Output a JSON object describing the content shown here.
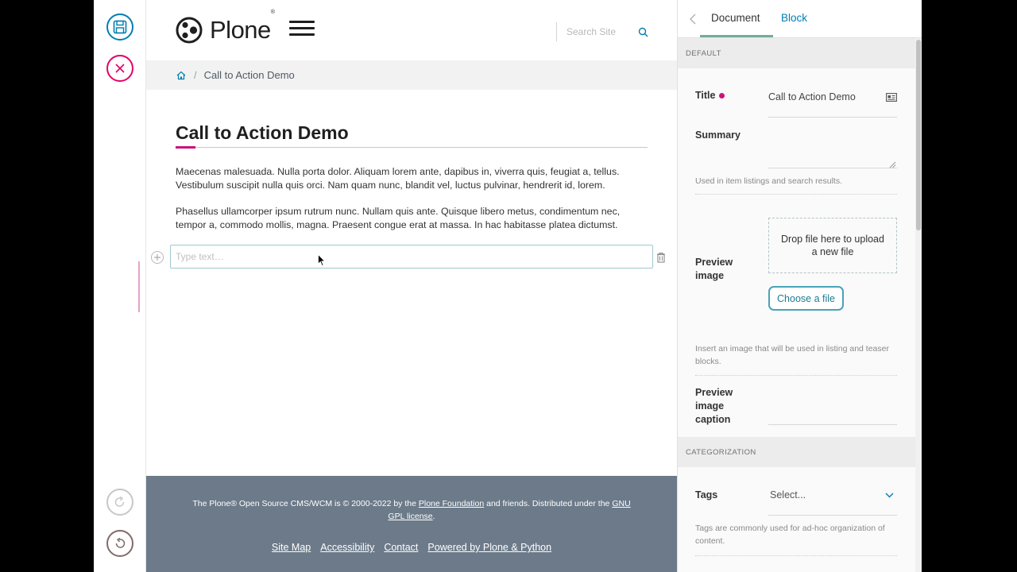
{
  "header": {
    "logo_text": "Plone",
    "logo_sup": "®",
    "search_placeholder": "Search Site"
  },
  "breadcrumb": {
    "items": [
      "Call to Action Demo"
    ]
  },
  "content": {
    "title": "Call to Action Demo",
    "paragraphs": [
      "Maecenas malesuada. Nulla porta dolor. Aliquam lorem ante, dapibus in, viverra quis, feugiat a, tellus. Vestibulum suscipit nulla quis orci. Nam quam nunc, blandit vel, luctus pulvinar, hendrerit id, lorem.",
      "Phasellus ullamcorper ipsum rutrum nunc. Nullam quis ante. Quisque libero metus, condimentum nec, tempor a, commodo mollis, magna. Praesent congue erat at massa. In hac habitasse platea dictumst."
    ],
    "text_block_placeholder": "Type text…"
  },
  "footer": {
    "text_1": "The Plone® Open Source CMS/WCM is © 2000-2022 by the ",
    "link_foundation": "Plone Foundation",
    "text_2": " and friends. Distributed under the ",
    "link_license": "GNU GPL license",
    "text_3": ".",
    "links": [
      "Site Map",
      "Accessibility",
      "Contact",
      "Powered by Plone & Python"
    ]
  },
  "sidebar": {
    "tabs": {
      "document": "Document",
      "block": "Block"
    },
    "sections": {
      "default": "DEFAULT",
      "categorization": "CATEGORIZATION"
    },
    "fields": {
      "title_label": "Title",
      "title_value": "Call to Action Demo",
      "summary_label": "Summary",
      "summary_help": "Used in item listings and search results.",
      "preview_image_label": "Preview image",
      "dropzone_text": "Drop file here to upload a new file",
      "choose_file": "Choose a file",
      "preview_image_help": "Insert an image that will be used in listing and teaser blocks.",
      "preview_caption_label": "Preview image caption",
      "tags_label": "Tags",
      "tags_placeholder": "Select...",
      "tags_help": "Tags are commonly used for ad-hoc organization of content."
    }
  },
  "colors": {
    "save": "#007eb1",
    "cancel": "#e40166",
    "accent": "#c9157a",
    "footer_bg": "#6c7a89"
  }
}
